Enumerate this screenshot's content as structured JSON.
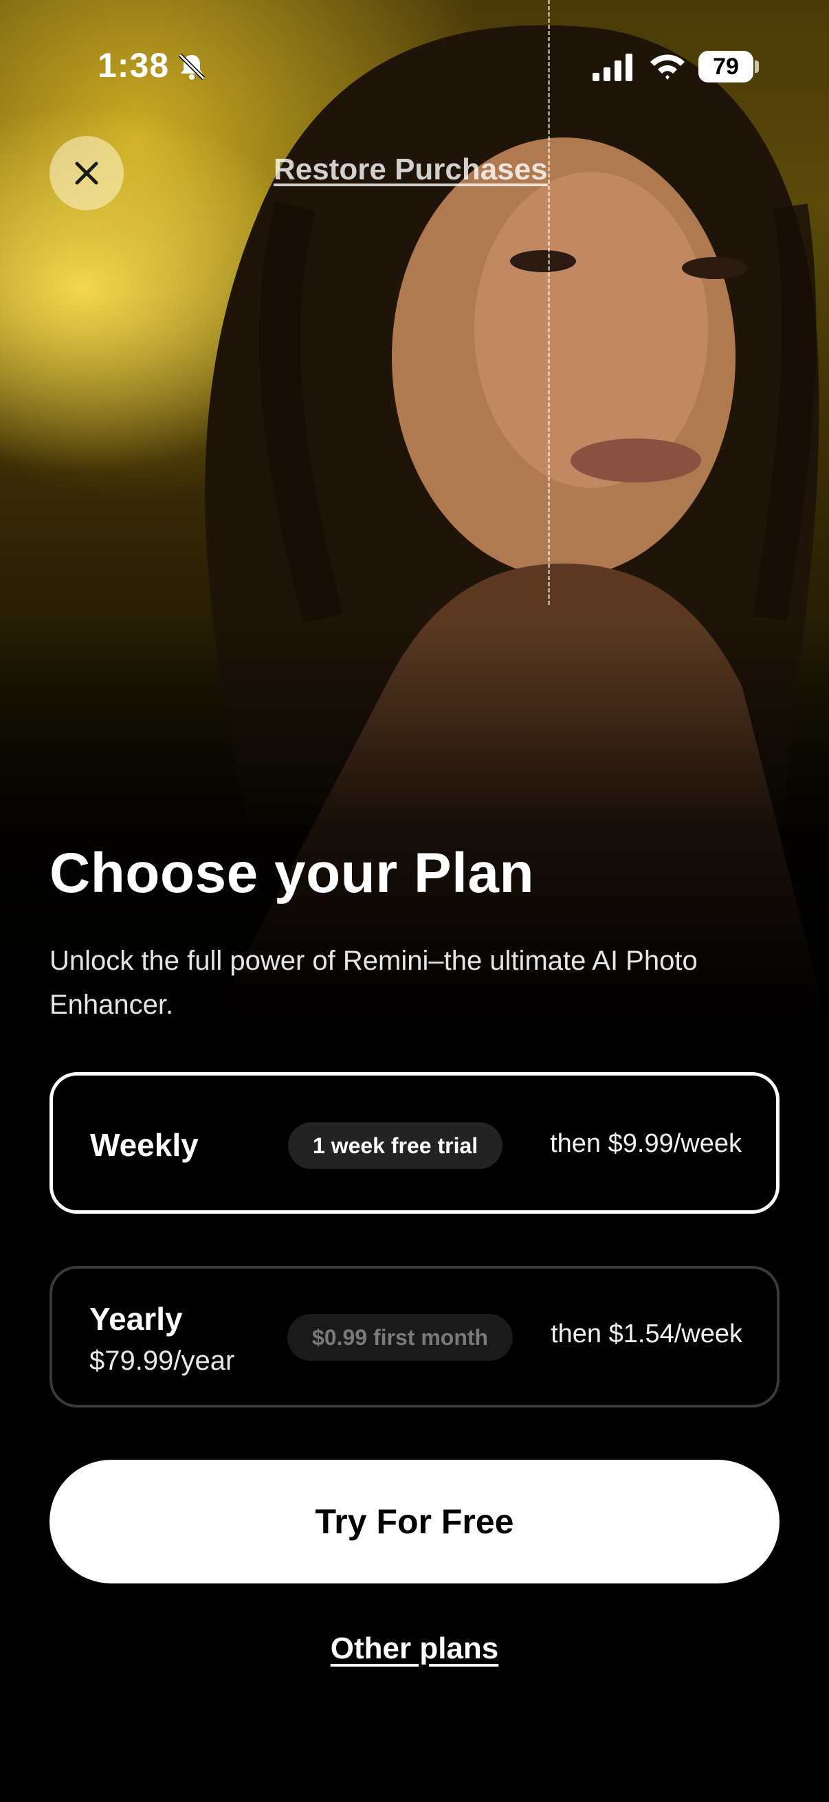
{
  "status_bar": {
    "time": "1:38",
    "battery": "79",
    "icons": [
      "bell-slash-icon",
      "signal-icon",
      "wifi-icon",
      "battery-icon"
    ]
  },
  "header": {
    "close_icon": "close-icon",
    "restore_label": "Restore Purchases"
  },
  "hero": {
    "description": "portrait-photo",
    "accent_color": "#e8c93a"
  },
  "content": {
    "title": "Choose your Plan",
    "subtitle": "Unlock the full power of Remini–the ultimate AI Photo Enhancer."
  },
  "plans": [
    {
      "name": "Weekly",
      "price": "",
      "badge": "1 week free trial",
      "then": "then $9.99/week",
      "selected": true
    },
    {
      "name": "Yearly",
      "price": "$79.99/year",
      "badge": "$0.99 first month",
      "then": "then $1.54/week",
      "selected": false
    }
  ],
  "cta": {
    "label": "Try For Free"
  },
  "footer": {
    "other_plans_label": "Other plans"
  },
  "colors": {
    "background": "#000000",
    "primary": "#ffffff",
    "unselected_border": "#3a3a3a"
  }
}
